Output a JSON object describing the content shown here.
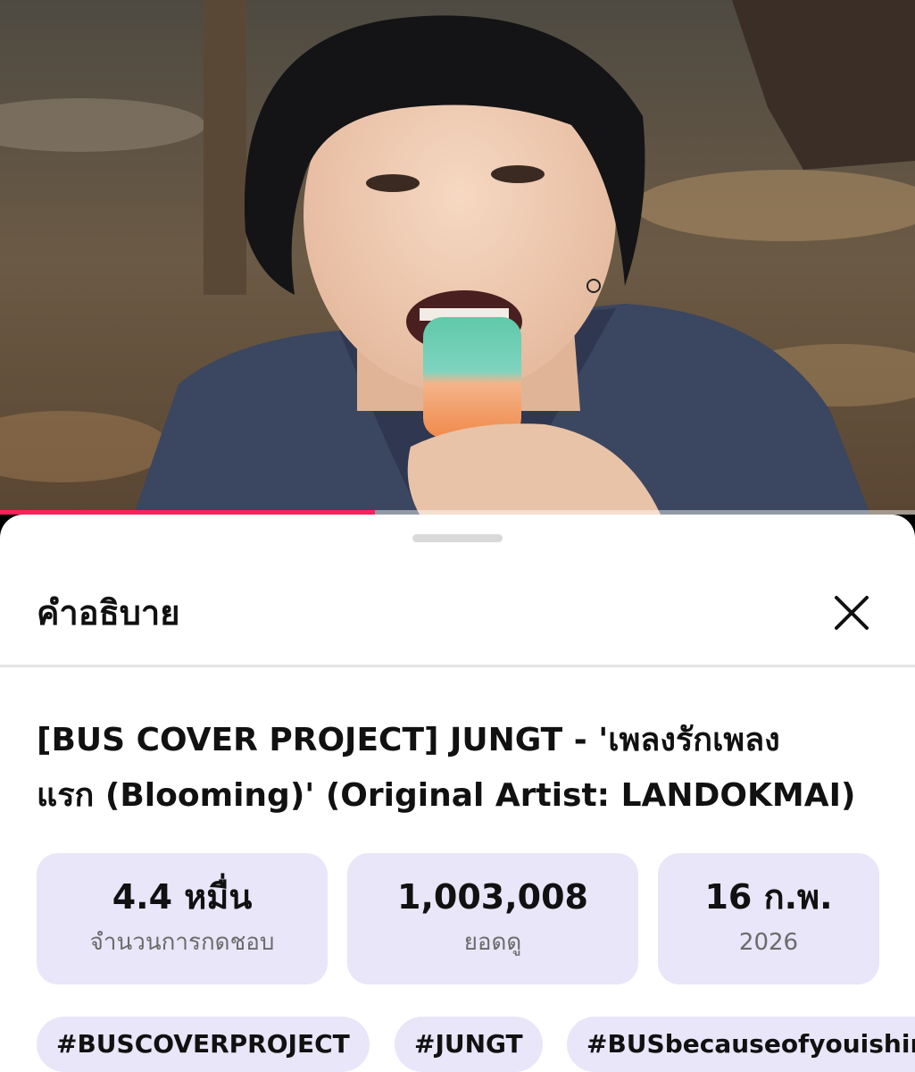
{
  "player": {
    "progress_fraction": 0.41,
    "progress_color": "#ff1f5a"
  },
  "sheet": {
    "title": "คำอธิบาย",
    "close_icon": "close-icon"
  },
  "video": {
    "title": "[BUS COVER PROJECT] JUNGT - 'เพลงรักเพลงแรก (Blooming)' (Original Artist: LANDOKMAI)",
    "title_line1": "[BUS COVER PROJECT] JUNGT - 'เพลงรักเพลง",
    "title_line2": "แรก (Blooming)' (Original Artist: LANDOKMAI)"
  },
  "stats": [
    {
      "value": "4.4 หมื่น",
      "label": "จำนวนการกดชอบ"
    },
    {
      "value": "1,003,008",
      "label": "ยอดดู"
    },
    {
      "value": "16 ก.พ.",
      "label": "2026"
    }
  ],
  "hashtags": [
    "#BUSCOVERPROJECT",
    "#JUNGT",
    "#BUSbecauseofyouishin"
  ],
  "colors": {
    "accent": "#ff1f5a",
    "chip_background": "#e8e6f8"
  }
}
